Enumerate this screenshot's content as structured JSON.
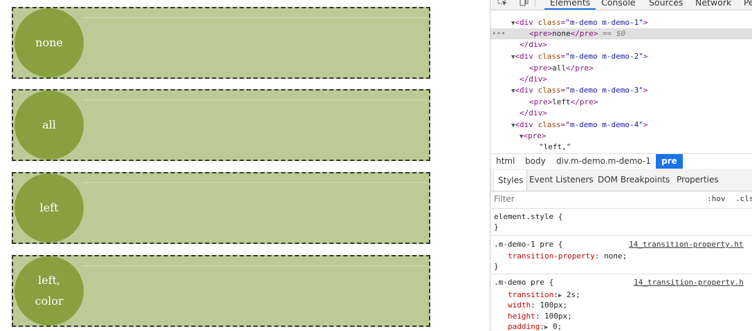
{
  "demos": [
    {
      "label": "none"
    },
    {
      "label": "all"
    },
    {
      "label": "left"
    },
    {
      "label": "left,\ncolor"
    }
  ],
  "devtools": {
    "tabs": [
      "Elements",
      "Console",
      "Sources",
      "Network",
      "Pe"
    ],
    "active_tab": "Elements",
    "dom": {
      "line1_class": "m-demo m-demo-1",
      "pre1_text": "none",
      "selected_ref": "== $0",
      "line2_class": "m-demo m-demo-2",
      "pre2_text": "all",
      "line3_class": "m-demo m-demo-3",
      "pre3_text": "left",
      "line4_class": "m-demo m-demo-4",
      "pre4_text": "\"left,\""
    },
    "breadcrumb": [
      "html",
      "body",
      "div.m-demo.m-demo-1",
      "pre"
    ],
    "subtabs": [
      "Styles",
      "Event Listeners",
      "DOM Breakpoints",
      "Properties"
    ],
    "filter_placeholder": "Filter",
    "hov": ":hov",
    "cls": ".cls",
    "styles": {
      "element_style": "element.style {",
      "close": "}",
      "rule1_selector": ".m-demo-1 pre {",
      "rule1_source": "14_transition-property.ht",
      "rule1_prop": "transition-property",
      "rule1_value": "none;",
      "rule2_selector": ".m-demo pre {",
      "rule2_source": "14_transition-property.h",
      "rule2_props": [
        {
          "name": "transition",
          "value": "2s;"
        },
        {
          "name": "width",
          "value": "100px;"
        },
        {
          "name": "height",
          "value": "100px;"
        },
        {
          "name": "padding",
          "value": "0;"
        }
      ]
    }
  }
}
